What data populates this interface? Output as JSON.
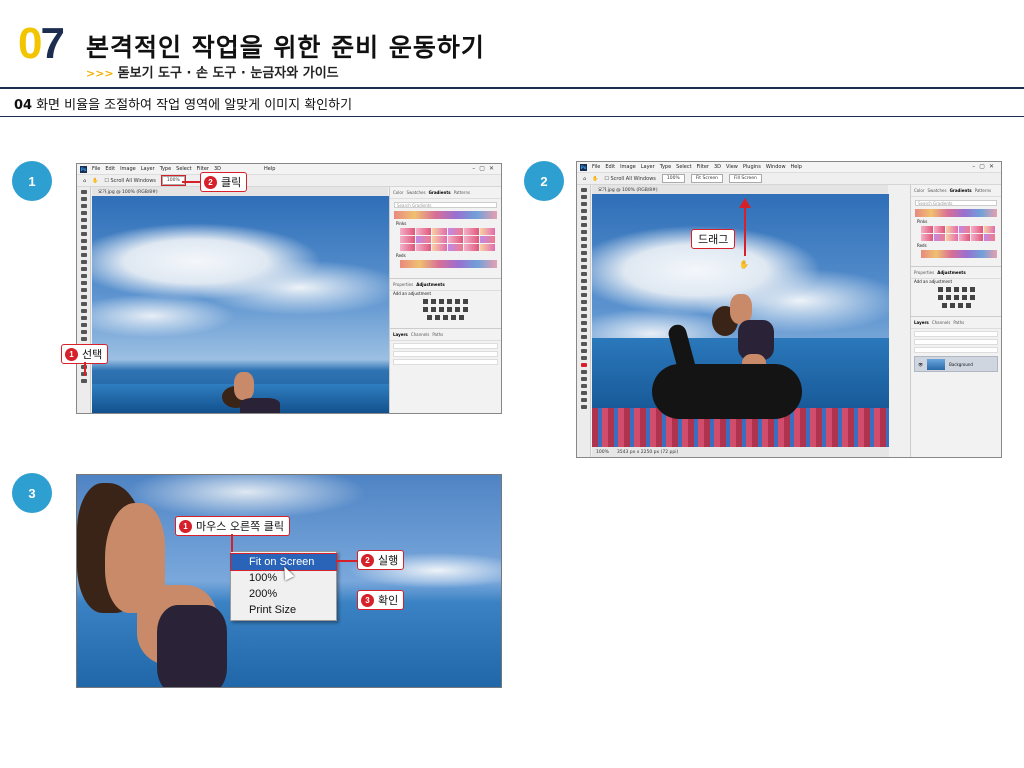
{
  "header": {
    "chapter_number_first": "0",
    "chapter_number_second": "7",
    "chapter_title": "본격적인 작업을 위한 준비 운동하기",
    "subtitle_arrows": ">>>",
    "subtitle": "돋보기 도구 · 손 도구 · 눈금자와 가이드"
  },
  "section": {
    "number": "04",
    "title": "화면 비율을 조절하여 작업 영역에 알맞게 이미지 확인하기"
  },
  "steps": [
    "1",
    "2",
    "3"
  ],
  "app": {
    "menu": [
      "File",
      "Edit",
      "Image",
      "Layer",
      "Type",
      "Select",
      "Filter",
      "3D",
      "View",
      "Plugins",
      "Window",
      "Help"
    ],
    "scroll_all_windows": "Scroll All Windows",
    "zoom_value": "100%",
    "fit_screen": "Fit Screen",
    "fill_screen": "Fill Screen",
    "doc_tab": "요가.jpg @ 100% (RGB/8#)",
    "panel_tabs_top": [
      "Color",
      "Swatches",
      "Gradients",
      "Patterns"
    ],
    "search_gradients": "Search Gradients",
    "group_pinks": "Pinks",
    "group_reds": "Reds",
    "panel_tabs_mid": [
      "Properties",
      "Adjustments"
    ],
    "add_adjustment": "Add an adjustment",
    "panel_tabs_bottom": [
      "Layers",
      "Channels",
      "Paths"
    ],
    "layer_name": "Background",
    "status_zoom": "100%",
    "status_size": "3543 px x 2250 px (72 ppi)"
  },
  "callouts": {
    "step1_select": {
      "num": "1",
      "text": "선택"
    },
    "step1_click": {
      "num": "2",
      "text": "클릭"
    },
    "step2_drag": {
      "text": "드래그"
    },
    "step3_rightclick": {
      "num": "1",
      "text": "마우스 오른쪽 클릭"
    },
    "step3_run": {
      "num": "2",
      "text": "실행"
    },
    "step3_confirm": {
      "num": "3",
      "text": "확인"
    }
  },
  "context_menu": {
    "items": [
      "Fit on Screen",
      "100%",
      "200%",
      "Print Size"
    ],
    "selected": "Fit on Screen"
  },
  "colors": {
    "accent_yellow": "#f2c500",
    "navy": "#1d2d4f",
    "step_blue": "#2e9fd1",
    "callout_red": "#d6202a"
  }
}
